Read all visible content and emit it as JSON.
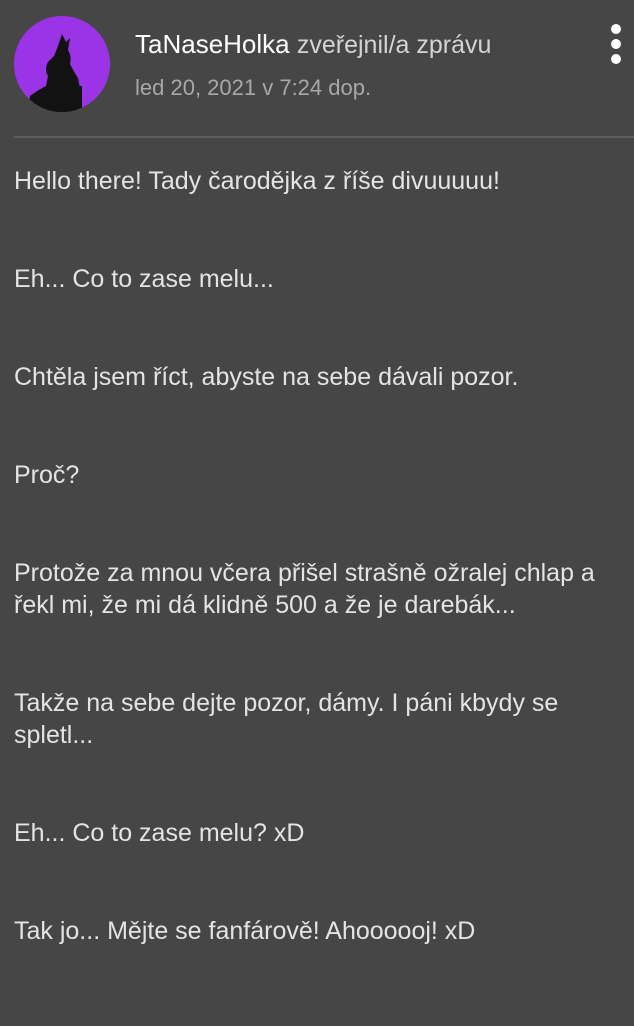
{
  "post": {
    "author": "TaNaseHolka",
    "action": "zveřejnil/a zprávu",
    "date": "led 20, 2021 v 7:24 dop.",
    "avatar_icon": "howling-wolf-icon",
    "menu_icon": "more-vertical-icon",
    "accent_color": "#9b33e6",
    "background_color": "#464646",
    "paragraphs": [
      "Hello there! Tady čarodějka z říše divuuuuu!",
      "Eh... Co to zase melu...",
      "Chtěla jsem říct, abyste na sebe dávali pozor.",
      "Proč?",
      "Protože za mnou včera přišel strašně ožralej chlap a řekl mi, že mi dá klidně 500 a že je darebák...",
      "Takže na sebe dejte pozor, dámy. I páni kbydy se spletl...",
      "Eh... Co to zase melu? xD",
      "Tak jo... Mějte se fanfárově! Ahoooooj! xD"
    ]
  }
}
